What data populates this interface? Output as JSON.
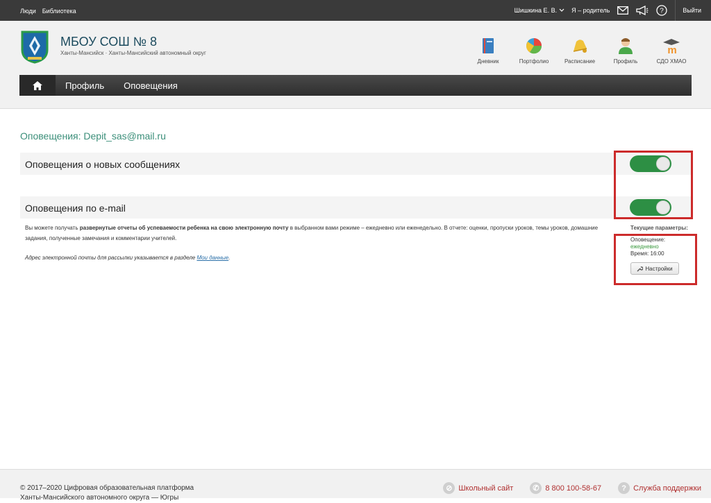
{
  "topbar": {
    "links": [
      "Люди",
      "Библиотека"
    ],
    "user": "Шишкина Е. В.",
    "role": "Я – родитель",
    "logout": "Выйти"
  },
  "header": {
    "school_name": "МБОУ СОШ № 8",
    "school_location": "Ханты-Мансийск · Ханты-Мансийский автономный округ",
    "nav": [
      {
        "label": "Дневник",
        "icon": "diary-icon"
      },
      {
        "label": "Портфолио",
        "icon": "portfolio-icon"
      },
      {
        "label": "Расписание",
        "icon": "schedule-bell-icon"
      },
      {
        "label": "Профиль",
        "icon": "profile-icon"
      },
      {
        "label": "СДО ХМАО",
        "icon": "moodle-icon"
      }
    ]
  },
  "menu": {
    "items": [
      "Профиль",
      "Оповещения"
    ]
  },
  "main": {
    "title": "Оповещения: Depit_sas@mail.ru",
    "row1_label": "Оповещения о новых сообщениях",
    "row2_label": "Оповещения по e-mail",
    "toggle1_on": true,
    "toggle2_on": true,
    "desc_pre": "Вы можете получать ",
    "desc_bold": "развернутые отчеты об успеваемости ребенка на свою электронную почту",
    "desc_post": " в выбранном вами режиме – ежедневно или еженедельно. В отчете: оценки, пропуски уроков, темы уроков, домашние задания, полученные замечания и комментарии учителей.",
    "note_text": "Адрес электронной почты для рассылки указывается в разделе ",
    "note_link": "Мои данные",
    "note_end": "."
  },
  "params": {
    "title": "Текущие параметры:",
    "notify_label": "Оповещение:",
    "frequency": "ежедневно",
    "time": "Время: 16:00",
    "settings_button": "Настройки"
  },
  "footer": {
    "copy_line1": "© 2017–2020 Цифровая образовательная платформа",
    "copy_line2": "Ханты-Мансийского автономного округа — Югры",
    "school_site": "Школьный сайт",
    "phone": "8 800 100-58-67",
    "support": "Служба поддержки"
  },
  "colors": {
    "accent": "#3c8f7a",
    "toggle_on": "#2d8f44",
    "highlight": "#cc2b2b",
    "footer_link": "#b03030"
  }
}
